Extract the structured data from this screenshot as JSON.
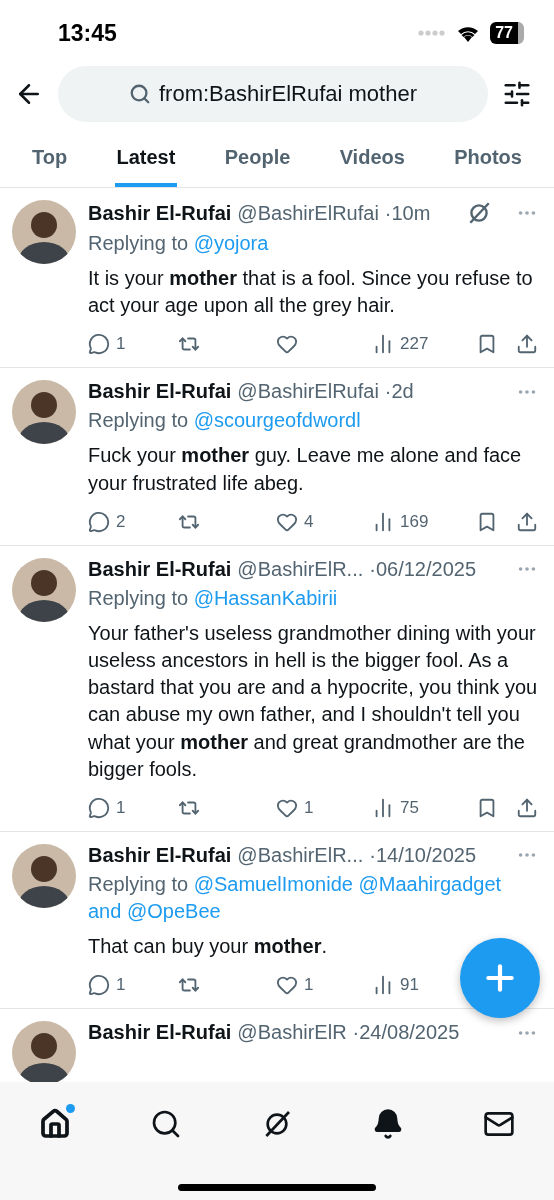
{
  "status_bar": {
    "time": "13:45",
    "battery": "77"
  },
  "search": {
    "value": "from:BashirElRufai mother"
  },
  "tabs": [
    {
      "label": "Top",
      "selected": false
    },
    {
      "label": "Latest",
      "selected": true
    },
    {
      "label": "People",
      "selected": false
    },
    {
      "label": "Videos",
      "selected": false
    },
    {
      "label": "Photos",
      "selected": false
    }
  ],
  "tweets": [
    {
      "name": "Bashir El-Rufai",
      "handle": "@BashirElRufai",
      "time": "·10m",
      "grok": true,
      "reply_label": "Replying to",
      "mentions": [
        "@yojora"
      ],
      "text": "It is your **mother** that is a fool. Since you refuse to act your age upon all the grey hair.",
      "actions": [
        {
          "kind": "reply",
          "count": "1"
        },
        {
          "kind": "repost"
        },
        {
          "kind": "like"
        },
        {
          "kind": "views",
          "count": "227"
        },
        {
          "kind": "bookmark"
        },
        {
          "kind": "share"
        }
      ]
    },
    {
      "name": "Bashir El-Rufai",
      "handle": "@BashirElRufai",
      "time": "·2d",
      "grok": false,
      "reply_label": "Replying to",
      "mentions": [
        "@scourgeofdwordl"
      ],
      "text": "Fuck your **mother** guy. Leave me alone and face your frustrated life abeg.",
      "actions": [
        {
          "kind": "reply",
          "count": "2"
        },
        {
          "kind": "repost"
        },
        {
          "kind": "like",
          "count": "4"
        },
        {
          "kind": "views",
          "count": "169"
        },
        {
          "kind": "bookmark"
        },
        {
          "kind": "share"
        }
      ]
    },
    {
      "name": "Bashir El-Rufai",
      "handle": "@BashirElR...",
      "time": "·06/12/2025",
      "grok": false,
      "reply_label": "Replying to",
      "mentions": [
        "@HassanKabirii"
      ],
      "text": "Your father's useless grandmother dining with your useless ancestors in hell is the bigger fool. As a bastard that you are and a hypocrite, you think you can abuse my own father, and I shouldn't tell you what your **mother** and great grandmother are the bigger fools.",
      "actions": [
        {
          "kind": "reply",
          "count": "1"
        },
        {
          "kind": "repost"
        },
        {
          "kind": "like",
          "count": "1"
        },
        {
          "kind": "views",
          "count": "75"
        },
        {
          "kind": "bookmark"
        },
        {
          "kind": "share"
        }
      ]
    },
    {
      "name": "Bashir El-Rufai",
      "handle": "@BashirElR...",
      "time": "·14/10/2025",
      "grok": false,
      "reply_label": "Replying to",
      "mentions": [
        "@SamuelImonide",
        "@Maahirgadget"
      ],
      "conjunction": "and",
      "last_mention": "@OpeBee",
      "text": "That can buy your **mother**.",
      "actions": [
        {
          "kind": "reply",
          "count": "1"
        },
        {
          "kind": "repost"
        },
        {
          "kind": "like",
          "count": "1"
        },
        {
          "kind": "views",
          "count": "91"
        }
      ]
    },
    {
      "name": "Bashir El-Rufai",
      "handle": "@BashirElR",
      "time": "·24/08/2025"
    }
  ],
  "nav": [
    {
      "kind": "home",
      "badge": true,
      "selected": true
    },
    {
      "kind": "search",
      "badge": false,
      "selected": false
    },
    {
      "kind": "grok",
      "badge": false,
      "selected": false
    },
    {
      "kind": "notifications",
      "badge": false,
      "selected": false
    },
    {
      "kind": "messages",
      "badge": false,
      "selected": false
    }
  ]
}
